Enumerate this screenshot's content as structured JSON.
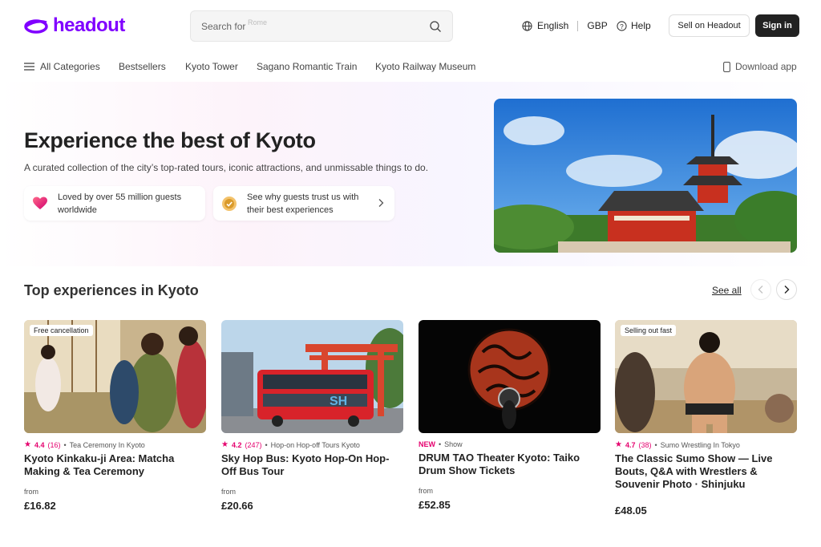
{
  "header": {
    "logo_text": "headout",
    "search_label": "Search for",
    "search_ghost": "Rome",
    "language": "English",
    "currency": "GBP",
    "help": "Help",
    "sell_label": "Sell on Headout",
    "signin_label": "Sign in"
  },
  "nav": {
    "items": [
      "All Categories",
      "Bestsellers",
      "Kyoto Tower",
      "Sagano Romantic Train",
      "Kyoto Railway Museum"
    ],
    "download": "Download app"
  },
  "hero": {
    "title": "Experience the best of Kyoto",
    "subtitle": "A curated collection of the city’s top-rated tours, iconic attractions, and unmissable things to do.",
    "trust_1": "Loved by over 55 million guests worldwide",
    "trust_2": "See why guests trust us with their best experiences"
  },
  "section": {
    "title": "Top experiences in Kyoto",
    "see_all": "See all"
  },
  "cards": [
    {
      "badge": "Free cancellation",
      "rating": "4.4",
      "count": "(16)",
      "category": "Tea Ceremony In Kyoto",
      "title": "Kyoto Kinkaku-ji Area: Matcha Making & Tea Ceremony",
      "from": "from",
      "price": "£16.82"
    },
    {
      "rating": "4.2",
      "count": "(247)",
      "category": "Hop-on Hop-off Tours Kyoto",
      "title": "Sky Hop Bus: Kyoto Hop-On Hop-Off Bus Tour",
      "from": "from",
      "price": "£20.66"
    },
    {
      "new": "NEW",
      "category": "Show",
      "title": "DRUM TAO Theater Kyoto: Taiko Drum Show Tickets",
      "from": "from",
      "price": "£52.85"
    },
    {
      "badge": "Selling out fast",
      "rating": "4.7",
      "count": "(38)",
      "category": "Sumo Wrestling In Tokyo",
      "title": "The Classic Sumo Show — Live Bouts, Q&A with Wrestlers & Souvenir Photo · Shinjuku",
      "price": "£48.05"
    }
  ],
  "colors": {
    "brand": "#8000ff",
    "accent_pink": "#e5006e"
  }
}
